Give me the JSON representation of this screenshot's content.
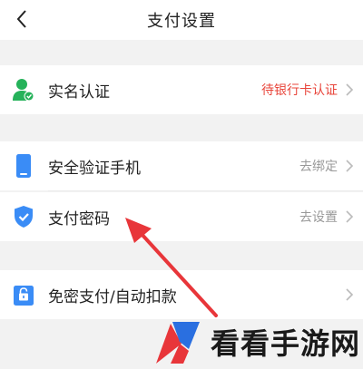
{
  "header": {
    "title": "支付设置",
    "back_icon": "chevron-left-icon"
  },
  "sections": {
    "realname": {
      "label": "实名认证",
      "value": "待银行卡认证",
      "value_color": "#e8443a",
      "icon": "user-verified-icon"
    },
    "phone": {
      "label": "安全验证手机",
      "value": "去绑定",
      "icon": "phone-icon"
    },
    "password": {
      "label": "支付密码",
      "value": "去设置",
      "icon": "shield-check-icon"
    },
    "nopassword": {
      "label": "免密支付/自动扣款",
      "value": "",
      "icon": "lock-icon"
    }
  },
  "colors": {
    "accent_blue": "#3a8cf6",
    "accent_green": "#25b25a",
    "annotation_red": "#e8363a"
  },
  "watermark": {
    "text": "看看手游网"
  }
}
